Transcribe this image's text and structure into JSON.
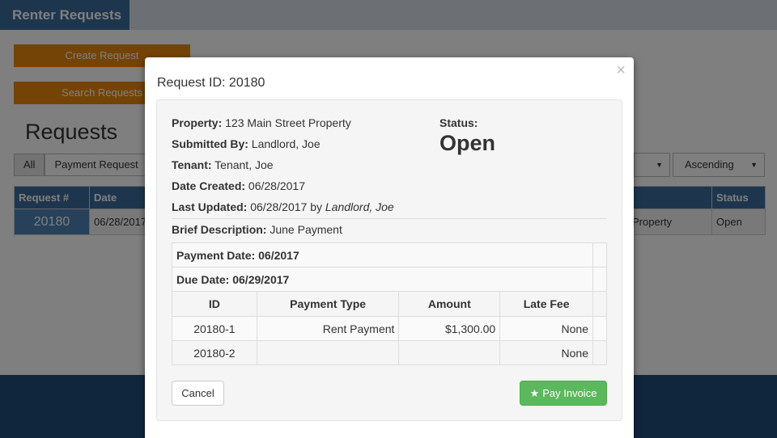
{
  "app": {
    "title": "Renter Requests"
  },
  "actions": {
    "create": "Create Request",
    "search": "Search Requests"
  },
  "page": {
    "heading": "Requests"
  },
  "filters": {
    "all": "All",
    "payment_request": "Payment Request"
  },
  "sort": {
    "order": "Ascending"
  },
  "table": {
    "headers": {
      "request_num": "Request #",
      "date": "Date",
      "status": "Status"
    },
    "row": {
      "request_num": "20180",
      "date": "06/28/2017",
      "property": "Property",
      "status": "Open"
    }
  },
  "modal": {
    "title": "Request ID: 20180",
    "close": "×",
    "property_label": "Property:",
    "property_value": "123 Main Street Property",
    "submitted_label": "Submitted By:",
    "submitted_value": "Landlord, Joe",
    "tenant_label": "Tenant:",
    "tenant_value": "Tenant, Joe",
    "created_label": "Date Created:",
    "created_value": "06/28/2017",
    "updated_label": "Last Updated:",
    "updated_value": "06/28/2017 by",
    "updated_by": "Landlord, Joe",
    "status_label": "Status:",
    "status_value": "Open",
    "brief_label": "Brief Description:",
    "brief_value": "June Payment",
    "payment_date": "Payment Date: 06/2017",
    "due_date": "Due Date: 06/29/2017",
    "columns": {
      "id": "ID",
      "type": "Payment Type",
      "amount": "Amount",
      "late_fee": "Late Fee"
    },
    "rows": [
      {
        "id": "20180-1",
        "type": "Rent Payment",
        "amount": "$1,300.00",
        "late_fee": "None"
      },
      {
        "id": "20180-2",
        "type": "",
        "amount": "",
        "late_fee": "None"
      }
    ],
    "cancel": "Cancel",
    "pay": "Pay Invoice"
  }
}
